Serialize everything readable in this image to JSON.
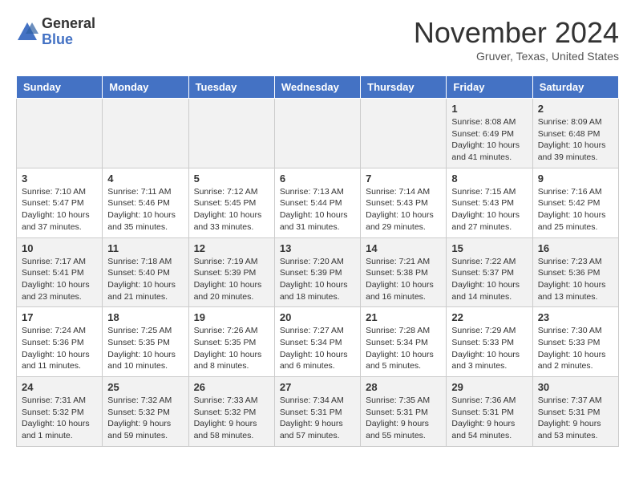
{
  "header": {
    "logo_general": "General",
    "logo_blue": "Blue",
    "month_title": "November 2024",
    "location": "Gruver, Texas, United States"
  },
  "days_of_week": [
    "Sunday",
    "Monday",
    "Tuesday",
    "Wednesday",
    "Thursday",
    "Friday",
    "Saturday"
  ],
  "weeks": [
    [
      {
        "day": "",
        "info": ""
      },
      {
        "day": "",
        "info": ""
      },
      {
        "day": "",
        "info": ""
      },
      {
        "day": "",
        "info": ""
      },
      {
        "day": "",
        "info": ""
      },
      {
        "day": "1",
        "info": "Sunrise: 8:08 AM\nSunset: 6:49 PM\nDaylight: 10 hours\nand 41 minutes."
      },
      {
        "day": "2",
        "info": "Sunrise: 8:09 AM\nSunset: 6:48 PM\nDaylight: 10 hours\nand 39 minutes."
      }
    ],
    [
      {
        "day": "3",
        "info": "Sunrise: 7:10 AM\nSunset: 5:47 PM\nDaylight: 10 hours\nand 37 minutes."
      },
      {
        "day": "4",
        "info": "Sunrise: 7:11 AM\nSunset: 5:46 PM\nDaylight: 10 hours\nand 35 minutes."
      },
      {
        "day": "5",
        "info": "Sunrise: 7:12 AM\nSunset: 5:45 PM\nDaylight: 10 hours\nand 33 minutes."
      },
      {
        "day": "6",
        "info": "Sunrise: 7:13 AM\nSunset: 5:44 PM\nDaylight: 10 hours\nand 31 minutes."
      },
      {
        "day": "7",
        "info": "Sunrise: 7:14 AM\nSunset: 5:43 PM\nDaylight: 10 hours\nand 29 minutes."
      },
      {
        "day": "8",
        "info": "Sunrise: 7:15 AM\nSunset: 5:43 PM\nDaylight: 10 hours\nand 27 minutes."
      },
      {
        "day": "9",
        "info": "Sunrise: 7:16 AM\nSunset: 5:42 PM\nDaylight: 10 hours\nand 25 minutes."
      }
    ],
    [
      {
        "day": "10",
        "info": "Sunrise: 7:17 AM\nSunset: 5:41 PM\nDaylight: 10 hours\nand 23 minutes."
      },
      {
        "day": "11",
        "info": "Sunrise: 7:18 AM\nSunset: 5:40 PM\nDaylight: 10 hours\nand 21 minutes."
      },
      {
        "day": "12",
        "info": "Sunrise: 7:19 AM\nSunset: 5:39 PM\nDaylight: 10 hours\nand 20 minutes."
      },
      {
        "day": "13",
        "info": "Sunrise: 7:20 AM\nSunset: 5:39 PM\nDaylight: 10 hours\nand 18 minutes."
      },
      {
        "day": "14",
        "info": "Sunrise: 7:21 AM\nSunset: 5:38 PM\nDaylight: 10 hours\nand 16 minutes."
      },
      {
        "day": "15",
        "info": "Sunrise: 7:22 AM\nSunset: 5:37 PM\nDaylight: 10 hours\nand 14 minutes."
      },
      {
        "day": "16",
        "info": "Sunrise: 7:23 AM\nSunset: 5:36 PM\nDaylight: 10 hours\nand 13 minutes."
      }
    ],
    [
      {
        "day": "17",
        "info": "Sunrise: 7:24 AM\nSunset: 5:36 PM\nDaylight: 10 hours\nand 11 minutes."
      },
      {
        "day": "18",
        "info": "Sunrise: 7:25 AM\nSunset: 5:35 PM\nDaylight: 10 hours\nand 10 minutes."
      },
      {
        "day": "19",
        "info": "Sunrise: 7:26 AM\nSunset: 5:35 PM\nDaylight: 10 hours\nand 8 minutes."
      },
      {
        "day": "20",
        "info": "Sunrise: 7:27 AM\nSunset: 5:34 PM\nDaylight: 10 hours\nand 6 minutes."
      },
      {
        "day": "21",
        "info": "Sunrise: 7:28 AM\nSunset: 5:34 PM\nDaylight: 10 hours\nand 5 minutes."
      },
      {
        "day": "22",
        "info": "Sunrise: 7:29 AM\nSunset: 5:33 PM\nDaylight: 10 hours\nand 3 minutes."
      },
      {
        "day": "23",
        "info": "Sunrise: 7:30 AM\nSunset: 5:33 PM\nDaylight: 10 hours\nand 2 minutes."
      }
    ],
    [
      {
        "day": "24",
        "info": "Sunrise: 7:31 AM\nSunset: 5:32 PM\nDaylight: 10 hours\nand 1 minute."
      },
      {
        "day": "25",
        "info": "Sunrise: 7:32 AM\nSunset: 5:32 PM\nDaylight: 9 hours\nand 59 minutes."
      },
      {
        "day": "26",
        "info": "Sunrise: 7:33 AM\nSunset: 5:32 PM\nDaylight: 9 hours\nand 58 minutes."
      },
      {
        "day": "27",
        "info": "Sunrise: 7:34 AM\nSunset: 5:31 PM\nDaylight: 9 hours\nand 57 minutes."
      },
      {
        "day": "28",
        "info": "Sunrise: 7:35 AM\nSunset: 5:31 PM\nDaylight: 9 hours\nand 55 minutes."
      },
      {
        "day": "29",
        "info": "Sunrise: 7:36 AM\nSunset: 5:31 PM\nDaylight: 9 hours\nand 54 minutes."
      },
      {
        "day": "30",
        "info": "Sunrise: 7:37 AM\nSunset: 5:31 PM\nDaylight: 9 hours\nand 53 minutes."
      }
    ]
  ]
}
